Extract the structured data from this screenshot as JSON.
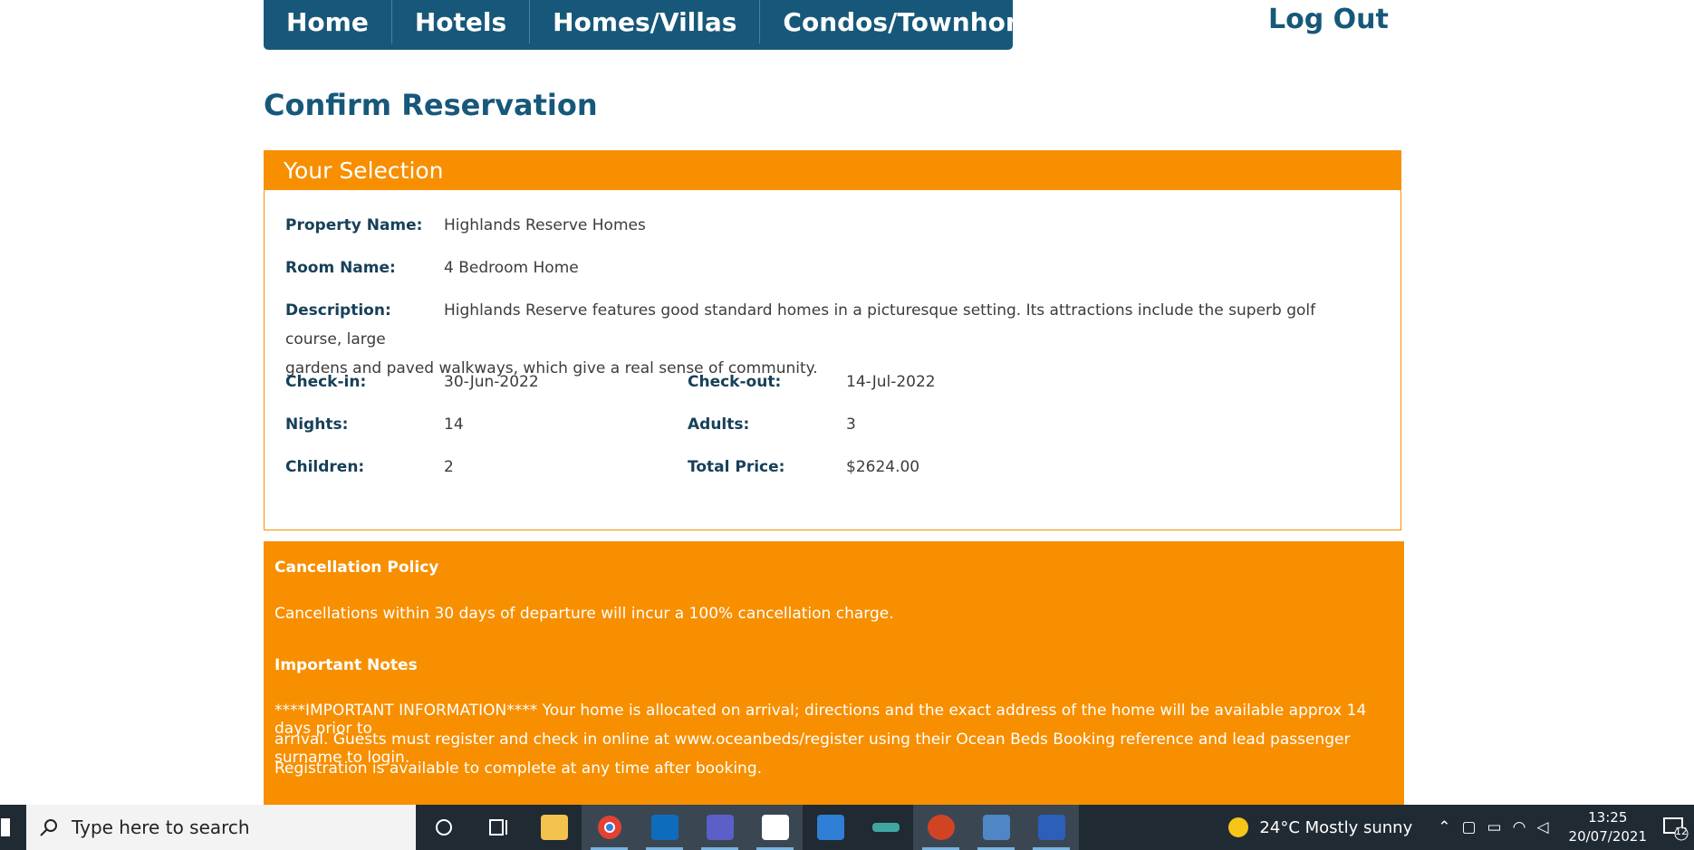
{
  "nav": {
    "items": [
      {
        "label": "Home"
      },
      {
        "label": "Hotels"
      },
      {
        "label": "Homes/Villas"
      },
      {
        "label": "Condos/Townhomes"
      }
    ],
    "logout_label": "Log Out"
  },
  "page": {
    "title": "Confirm Reservation"
  },
  "selection": {
    "header": "Your Selection",
    "property_name_label": "Property Name:",
    "property_name": "Highlands Reserve Homes",
    "room_name_label": "Room Name:",
    "room_name": "4 Bedroom Home",
    "description_label": "Description:",
    "description_line1": "Highlands Reserve features good standard homes in a picturesque setting. Its attractions include the superb golf course, large",
    "description_line2": "gardens and paved walkways, which give a real sense of community.",
    "checkin_label": "Check-in:",
    "checkin": "30-Jun-2022",
    "checkout_label": "Check-out:",
    "checkout": "14-Jul-2022",
    "nights_label": "Nights:",
    "nights": "14",
    "adults_label": "Adults:",
    "adults": "3",
    "children_label": "Children:",
    "children": "2",
    "total_price_label": "Total Price:",
    "total_price": "$2624.00"
  },
  "policy": {
    "cancellation_heading": "Cancellation Policy",
    "cancellation_text": "Cancellations within 30 days of departure will incur a 100% cancellation charge.",
    "notes_heading": "Important Notes",
    "notes_line1": "****IMPORTANT INFORMATION**** Your home is allocated on arrival; directions and the exact address of the home will be available approx 14 days prior to",
    "notes_line2": "arrival. Guests must register and check in online at www.oceanbeds/register using their Ocean Beds Booking reference and lead passenger surname to login.",
    "notes_line3": "Registration is available to complete at any time after booking."
  },
  "taskbar": {
    "search_placeholder": "Type here to search",
    "apps": [
      {
        "name": "cortana-icon",
        "color": "#202a33"
      },
      {
        "name": "task-view-icon",
        "color": "#202a33"
      },
      {
        "name": "file-explorer-icon",
        "color": "#f2c14e"
      },
      {
        "name": "chrome-icon",
        "color": "#e34133"
      },
      {
        "name": "outlook-icon",
        "color": "#0f6cbd"
      },
      {
        "name": "teams-icon",
        "color": "#5b5fc7"
      },
      {
        "name": "photos-icon",
        "color": "#ffffff"
      },
      {
        "name": "power-automate-icon",
        "color": "#2f7fd6"
      },
      {
        "name": "app-icon",
        "color": "#3fa7a0"
      },
      {
        "name": "powerpoint-icon",
        "color": "#d04424"
      },
      {
        "name": "remote-desktop-icon",
        "color": "#4f86c6"
      },
      {
        "name": "word-icon",
        "color": "#2b5fb8"
      }
    ],
    "weather": "24°C  Mostly sunny",
    "time": "13:25",
    "date": "20/07/2021",
    "notification_count": "12"
  },
  "colors": {
    "nav_bg": "#17587a",
    "accent_orange": "#f78f00",
    "heading_blue": "#17587a",
    "taskbar_bg": "#202a33"
  }
}
